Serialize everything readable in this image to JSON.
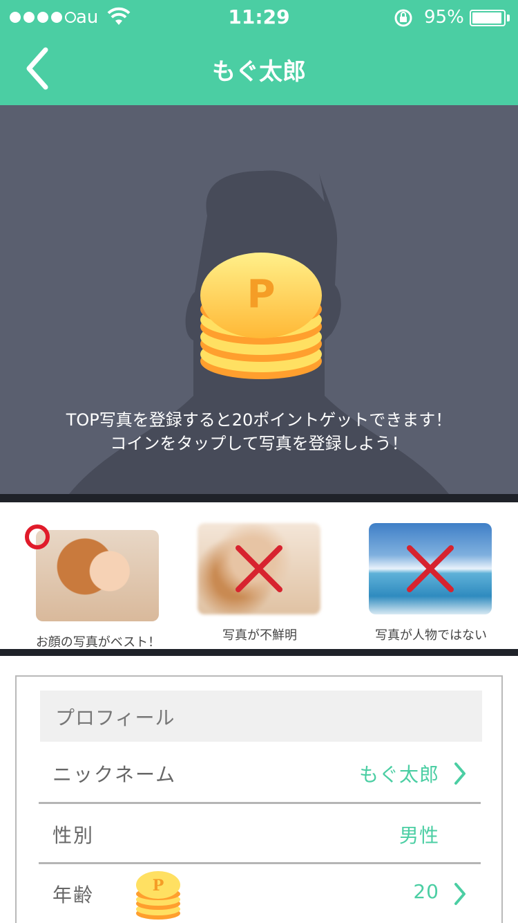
{
  "status_bar": {
    "carrier": "au",
    "time": "11:29",
    "battery_percent": "95%",
    "battery_level": 0.95,
    "signal_bars_filled": 4,
    "signal_bars_total": 5
  },
  "nav": {
    "title": "もぐ太郎",
    "back_icon": "chevron-left-icon"
  },
  "hero": {
    "message_line1": "TOP写真を登録すると20ポイントゲットできます！",
    "message_line2": "コインをタップして写真を登録しよう！",
    "coin_mark": "P"
  },
  "examples": [
    {
      "caption": "お顔の写真がベスト！",
      "verdict": "ok"
    },
    {
      "caption": "写真が不鮮明",
      "verdict": "ng"
    },
    {
      "caption": "写真が人物ではない",
      "verdict": "ng"
    }
  ],
  "profile": {
    "header": "プロフィール",
    "rows": [
      {
        "label": "ニックネーム",
        "value": "もぐ太郎",
        "chevron": true
      },
      {
        "label": "性別",
        "value": "男性",
        "chevron": false
      },
      {
        "label": "年齢",
        "value": "20",
        "chevron": true,
        "coin_mark": "P"
      }
    ]
  },
  "colors": {
    "accent": "#4bcea3",
    "hero_bg": "#5a5f6f",
    "ok_mark": "#e01b2a",
    "coin_gold": "#ffd84a"
  }
}
